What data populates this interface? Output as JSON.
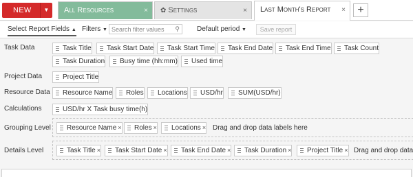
{
  "tabs": {
    "new_label": "NEW",
    "resources_label": "All Resources",
    "settings_label": "Settings",
    "report_label": "Last Month's Report",
    "close_glyph": "×"
  },
  "toolbar": {
    "fields_label": "Select Report Fields",
    "filters_label": "Filters",
    "search_placeholder": "Search filter values",
    "period_label": "Default period",
    "save_label": "Save report"
  },
  "sections": {
    "task_data": {
      "label": "Task Data",
      "chips": [
        "Task Title",
        "Task Start Date",
        "Task Start Time",
        "Task End Date",
        "Task End Time",
        "Task Count",
        "Task Duration",
        "Busy time (hh:mm)",
        "Used time"
      ]
    },
    "project_data": {
      "label": "Project Data",
      "chips": [
        "Project Title"
      ]
    },
    "resource_data": {
      "label": "Resource Data",
      "chips": [
        "Resource Name",
        "Roles",
        "Locations",
        "USD/hr",
        "SUM(USD/hr)"
      ]
    },
    "calculations": {
      "label": "Calculations",
      "chips": [
        "USD/hr X Task busy time(h)"
      ]
    },
    "grouping": {
      "label": "Grouping Level",
      "chips": [
        "Resource Name",
        "Roles",
        "Locations"
      ],
      "hint": "Drag and drop data labels here"
    },
    "details": {
      "label": "Details Level",
      "chips": [
        "Task Title",
        "Task Start Date",
        "Task End Date",
        "Task Duration",
        "Project Title"
      ],
      "hint": "Drag and drop data labels here"
    }
  },
  "colors": {
    "new_button": "#d42a2a",
    "resources_tab": "#83bb9b",
    "settings_tab": "#e4e4e4"
  }
}
